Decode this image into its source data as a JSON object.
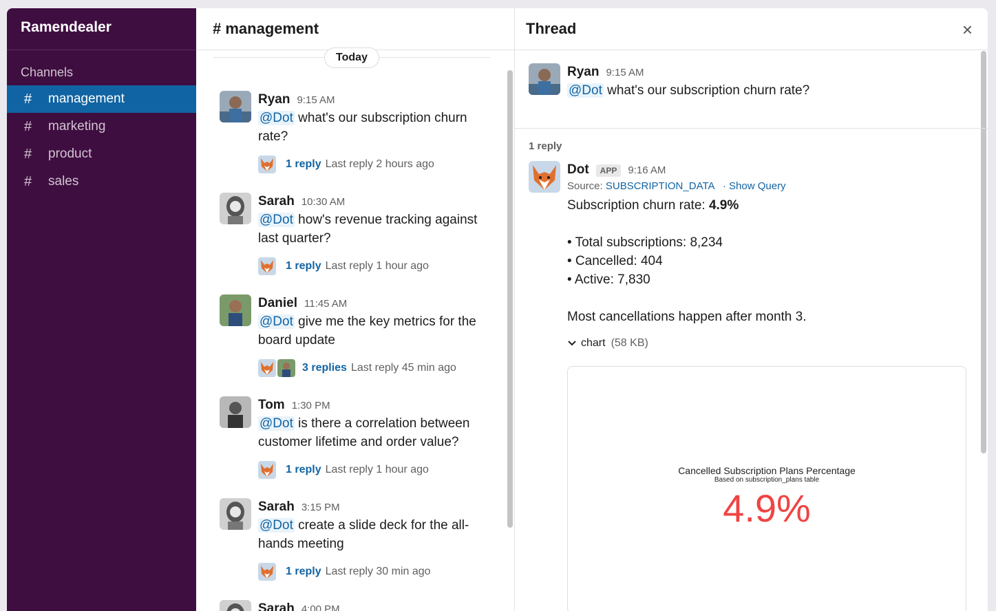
{
  "workspace": {
    "name": "Ramendealer"
  },
  "sidebar": {
    "section_label": "Channels",
    "channels": [
      {
        "label": "management",
        "active": true
      },
      {
        "label": "marketing",
        "active": false
      },
      {
        "label": "product",
        "active": false
      },
      {
        "label": "sales",
        "active": false
      }
    ]
  },
  "channel": {
    "title": "# management",
    "date_divider": "Today",
    "messages": [
      {
        "name": "Ryan",
        "time": "9:15 AM",
        "mention": "@Dot",
        "text": "what's our subscription churn rate?",
        "reply_count": "1 reply",
        "last_reply": "Last reply 2 hours ago"
      },
      {
        "name": "Sarah",
        "time": "10:30 AM",
        "mention": "@Dot",
        "text": "how's revenue tracking against last quarter?",
        "reply_count": "1 reply",
        "last_reply": "Last reply 1 hour ago"
      },
      {
        "name": "Daniel",
        "time": "11:45 AM",
        "mention": "@Dot",
        "text": "give me the key metrics for the board update",
        "reply_count": "3 replies",
        "last_reply": "Last reply 45 min ago"
      },
      {
        "name": "Tom",
        "time": "1:30 PM",
        "mention": "@Dot",
        "text": "is there a correlation between customer lifetime and order value?",
        "reply_count": "1 reply",
        "last_reply": "Last reply 1 hour ago"
      },
      {
        "name": "Sarah",
        "time": "3:15 PM",
        "mention": "@Dot",
        "text": "create a slide deck for the all-hands meeting",
        "reply_count": "1 reply",
        "last_reply": "Last reply 30 min ago"
      },
      {
        "name": "Sarah",
        "time": "4:00 PM"
      }
    ]
  },
  "thread": {
    "title": "Thread",
    "close_icon": "×",
    "parent": {
      "name": "Ryan",
      "time": "9:15 AM",
      "mention": "@Dot",
      "text": "what's our subscription churn rate?"
    },
    "reply_count": "1 reply",
    "reply": {
      "name": "Dot",
      "badge": "APP",
      "time": "9:16 AM",
      "source_label": "Source:",
      "source_value": "SUBSCRIPTION_DATA",
      "show_query": "· Show Query",
      "churn_label": "Subscription churn rate:",
      "churn_value": "4.9%",
      "bullets": [
        "• Total subscriptions: 8,234",
        "• Cancelled: 404",
        "• Active: 7,830"
      ],
      "note": "Most cancellations happen after month 3.",
      "attachment_name": "chart",
      "attachment_size": "(58 KB)",
      "chart_title": "Cancelled Subscription Plans Percentage",
      "chart_subtitle": "Based on subscription_plans table",
      "chart_value": "4.9%"
    }
  },
  "colors": {
    "sidebar_bg": "#3f0e40",
    "active_channel": "#1164a3",
    "link": "#1264a3",
    "chart_value": "#ef4444"
  }
}
